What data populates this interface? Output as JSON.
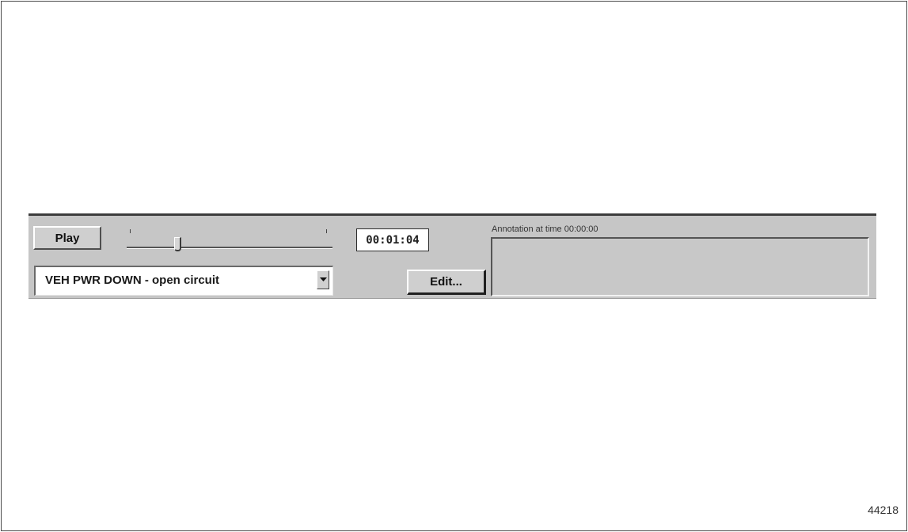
{
  "controls": {
    "play_label": "Play",
    "time_display": "00:01:04",
    "edit_label": "Edit...",
    "selected_item": "VEH PWR DOWN - open circuit",
    "slider_position": 0.24
  },
  "annotation": {
    "label": "Annotation at time 00:00:00",
    "text": ""
  },
  "figure_number": "44218",
  "icons": {
    "dropdown": "chevron-down-icon"
  },
  "colors": {
    "panel": "#c6c6c6",
    "panel_top_border": "#3c3c3c"
  }
}
